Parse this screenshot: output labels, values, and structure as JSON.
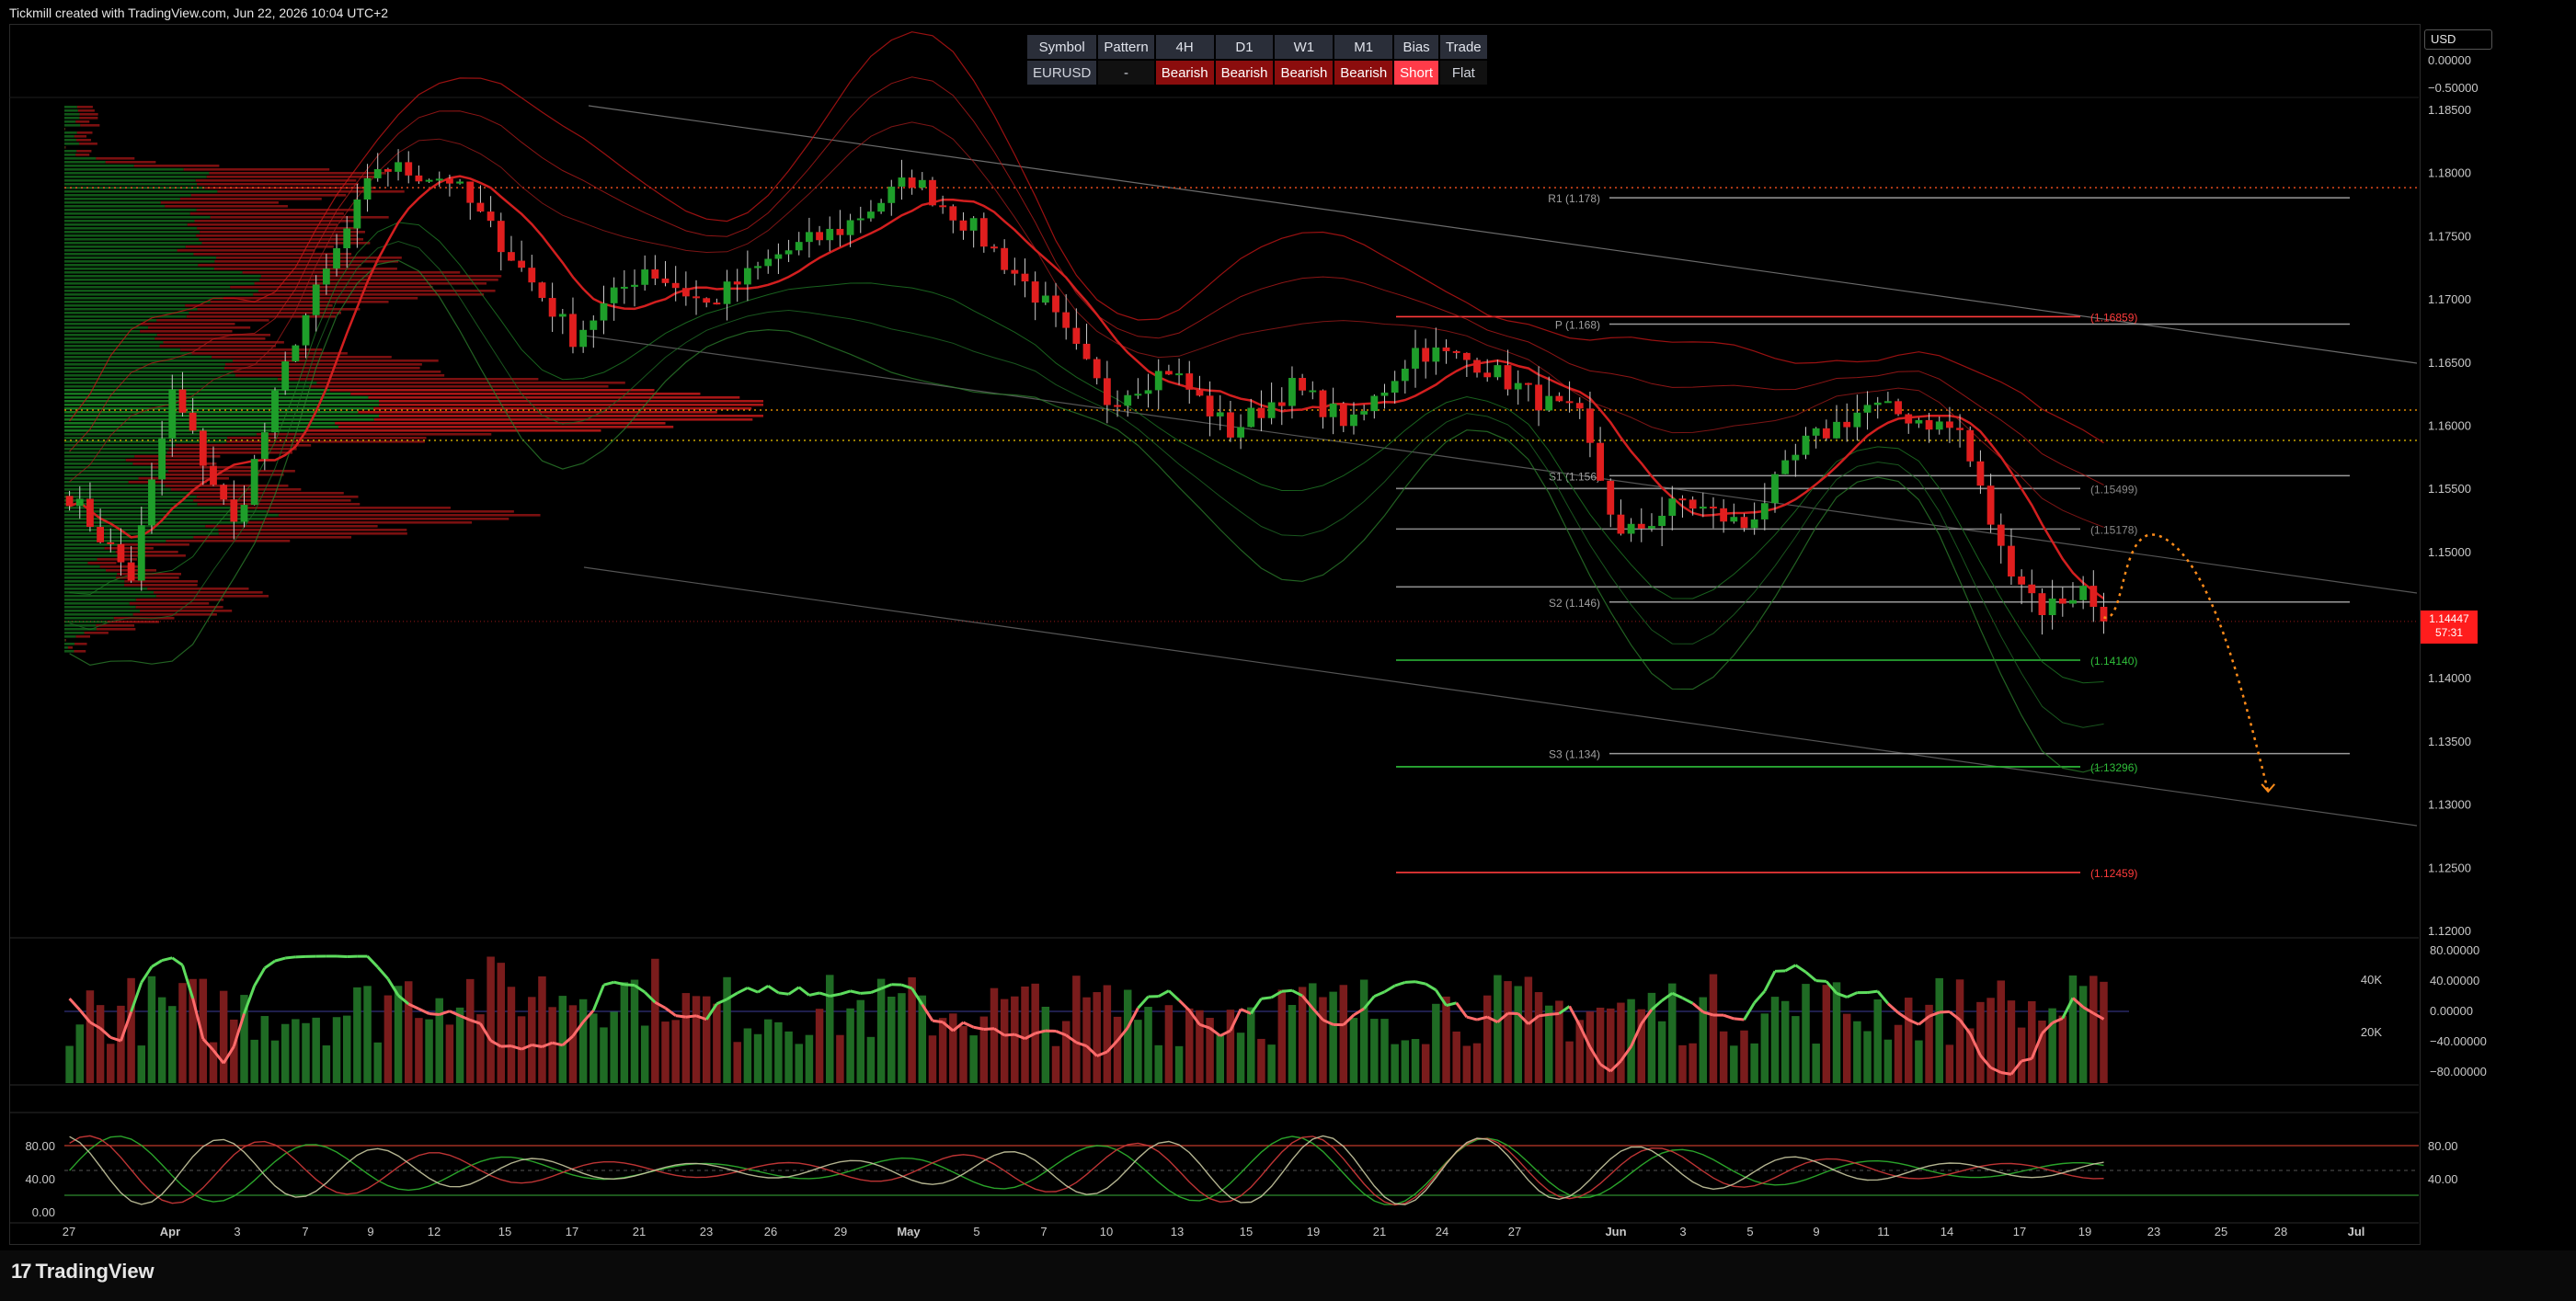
{
  "header": {
    "attribution": "Tickmill created with TradingView.com, Jun 22, 2026 10:04 UTC+2"
  },
  "signal_table": {
    "headers": [
      "Symbol",
      "Pattern",
      "4H",
      "D1",
      "W1",
      "M1",
      "Bias",
      "Trade"
    ],
    "values": [
      "EURUSD",
      "-",
      "Bearish",
      "Bearish",
      "Bearish",
      "Bearish",
      "Short",
      "Flat"
    ]
  },
  "currency_button": "USD",
  "price_tag": {
    "price": "1.14447",
    "countdown": "57:31"
  },
  "brand": "TradingView",
  "colors": {
    "bull": "#1e9e2a",
    "bear": "#e01e1e",
    "pivot": "#a9a9a9",
    "forecast": "#ff8c1a"
  },
  "chart_data": {
    "type": "candlestick",
    "symbol": "EURUSD",
    "price_axis": [
      "1.18500",
      "1.18000",
      "1.17500",
      "1.17000",
      "1.16500",
      "1.16000",
      "1.15500",
      "1.15000",
      "1.14500",
      "1.14000",
      "1.13500",
      "1.13000",
      "1.12500",
      "1.12000"
    ],
    "upper_scale": [
      "0.00000",
      "−0.50000"
    ],
    "ylim": [
      1.12,
      1.1858
    ],
    "x_ticks": [
      "27",
      "Apr",
      "3",
      "7",
      "9",
      "12",
      "15",
      "17",
      "21",
      "23",
      "26",
      "29",
      "May",
      "5",
      "7",
      "10",
      "13",
      "15",
      "19",
      "21",
      "24",
      "27",
      "Jun",
      "3",
      "5",
      "9",
      "11",
      "14",
      "17",
      "19",
      "23",
      "25",
      "28",
      "Jul"
    ],
    "close_path": [
      [
        0,
        1.1545
      ],
      [
        6,
        1.148
      ],
      [
        10,
        1.1625
      ],
      [
        16,
        1.152
      ],
      [
        22,
        1.167
      ],
      [
        30,
        1.1805
      ],
      [
        37,
        1.1795
      ],
      [
        42,
        1.1745
      ],
      [
        49,
        1.167
      ],
      [
        56,
        1.1725
      ],
      [
        62,
        1.1695
      ],
      [
        69,
        1.1735
      ],
      [
        75,
        1.1755
      ],
      [
        82,
        1.1795
      ],
      [
        88,
        1.1755
      ],
      [
        95,
        1.1695
      ],
      [
        101,
        1.162
      ],
      [
        107,
        1.1645
      ],
      [
        113,
        1.1595
      ],
      [
        119,
        1.163
      ],
      [
        125,
        1.16
      ],
      [
        131,
        1.166
      ],
      [
        137,
        1.165
      ],
      [
        143,
        1.162
      ],
      [
        147,
        1.1605
      ],
      [
        151,
        1.151
      ],
      [
        157,
        1.154
      ],
      [
        163,
        1.152
      ],
      [
        169,
        1.1585
      ],
      [
        175,
        1.1615
      ],
      [
        180,
        1.1605
      ],
      [
        184,
        1.1595
      ],
      [
        188,
        1.15
      ],
      [
        192,
        1.1455
      ],
      [
        196,
        1.147
      ],
      [
        198,
        1.1445
      ]
    ],
    "ohlc_last": {
      "close": 1.14447
    },
    "pivot_levels": [
      {
        "label": "R1 (1.178)",
        "value": 1.178
      },
      {
        "label": "P (1.168)",
        "value": 1.168
      },
      {
        "label": "S1 (1.156)",
        "value": 1.156
      },
      {
        "label": "S2 (1.146)",
        "value": 1.146
      },
      {
        "label": "S3 (1.134)",
        "value": 1.134
      }
    ],
    "fib_levels": [
      {
        "label": "(1.16859)",
        "value": 1.16859,
        "color": "red"
      },
      {
        "label": "(1.15499)",
        "value": 1.15499,
        "color": "gray"
      },
      {
        "label": "(1.15178)",
        "value": 1.15178,
        "color": "gray"
      },
      {
        "value": 1.1472,
        "color": "gray"
      },
      {
        "label": "(1.14140)",
        "value": 1.1414,
        "color": "green"
      },
      {
        "label": "(1.13296)",
        "value": 1.13296,
        "color": "green"
      },
      {
        "label": "(1.12459)",
        "value": 1.12459,
        "color": "red"
      }
    ],
    "horizontal_dotted": [
      1.1788,
      1.1612,
      1.1588
    ],
    "forecast_path": [
      [
        198,
        1.1448
      ],
      [
        204,
        1.151
      ],
      [
        214,
        1.131
      ]
    ],
    "volume_panel": {
      "axis_left": [
        "40K",
        "20K"
      ],
      "axis_right": [
        "80.00000",
        "40.00000",
        "0.00000",
        "−40.00000",
        "−80.00000"
      ]
    },
    "stoch_panel": {
      "axis_left": [
        "80.00",
        "40.00",
        "0.00"
      ],
      "axis_right": [
        "80.00",
        "40.00"
      ],
      "bands": [
        80,
        20
      ]
    }
  }
}
